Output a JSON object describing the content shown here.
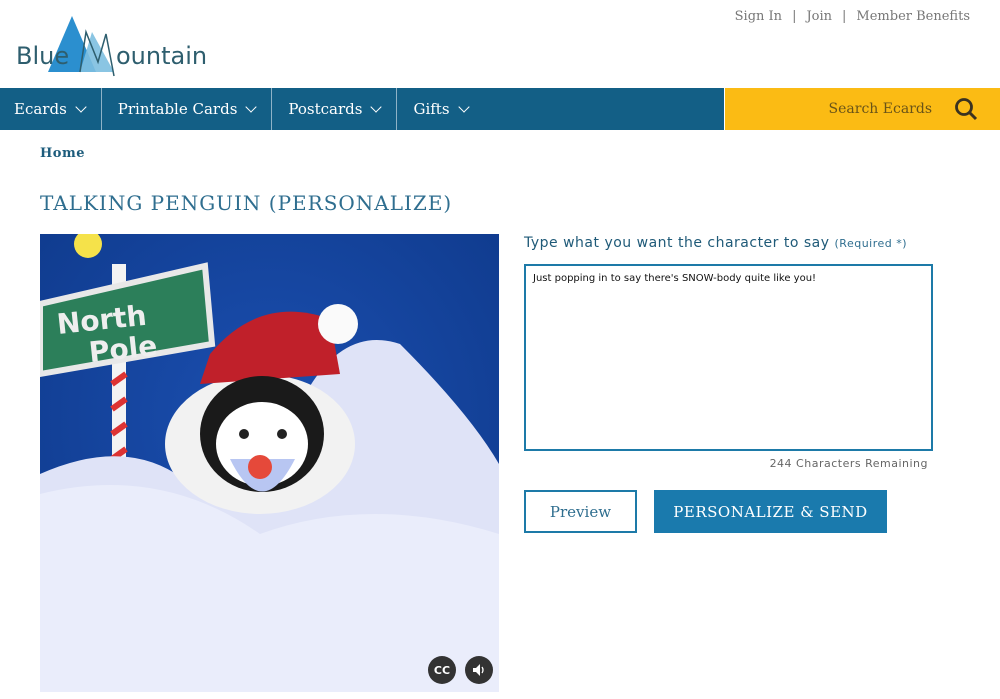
{
  "brand": {
    "name": "BlueMountain",
    "logo_text_left": "Blue",
    "logo_text_right": "ountain",
    "colors": {
      "nav": "#135f86",
      "search": "#fbbb14",
      "accent": "#1a7aad"
    }
  },
  "top_links": [
    "Sign In",
    "Join",
    "Member Benefits"
  ],
  "nav": {
    "items": [
      "Ecards",
      "Printable Cards",
      "Postcards",
      "Gifts"
    ]
  },
  "search": {
    "placeholder": "Search Ecards",
    "icon": "search-icon"
  },
  "breadcrumb": {
    "home": "Home"
  },
  "page_title": "TALKING PENGUIN (PERSONALIZE)",
  "media": {
    "sign_line1": "North",
    "sign_line2": "Pole",
    "controls": {
      "captions": "CC",
      "sound_icon": "speaker-icon"
    }
  },
  "form": {
    "prompt": "Type what you want the character to say",
    "required": "(Required *)",
    "message": "Just popping in to say there's SNOW-body quite like you!",
    "remaining": "244 Characters Remaining",
    "preview_label": "Preview",
    "send_label": "PERSONALIZE & SEND"
  }
}
